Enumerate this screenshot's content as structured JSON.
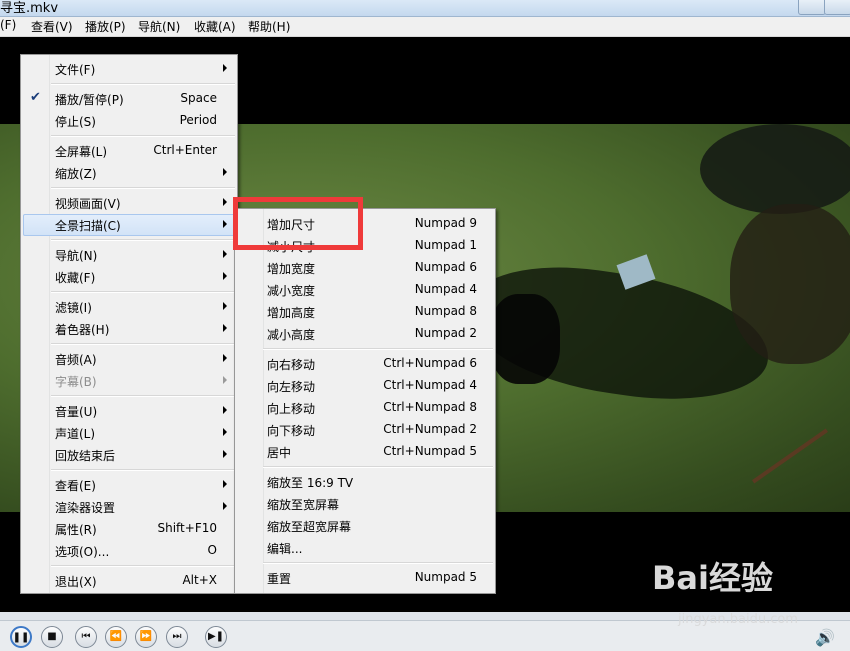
{
  "window": {
    "title": "寻宝.mkv"
  },
  "menubar": [
    "(F)",
    "查看(V)",
    "播放(P)",
    "导航(N)",
    "收藏(A)",
    "帮助(H)"
  ],
  "context_menu": {
    "items": [
      {
        "label": "文件(F)",
        "shortcut": "",
        "submenu": true
      },
      {
        "label": "播放/暂停(P)",
        "shortcut": "Space",
        "checked": true
      },
      {
        "label": "停止(S)",
        "shortcut": "Period"
      },
      {
        "label": "全屏幕(L)",
        "shortcut": "Ctrl+Enter"
      },
      {
        "label": "缩放(Z)",
        "shortcut": "",
        "submenu": true
      },
      {
        "label": "视频画面(V)",
        "shortcut": "",
        "submenu": true
      },
      {
        "label": "全景扫描(C)",
        "shortcut": "",
        "submenu": true,
        "highlighted": true
      },
      {
        "label": "导航(N)",
        "shortcut": "",
        "submenu": true
      },
      {
        "label": "收藏(F)",
        "shortcut": "",
        "submenu": true
      },
      {
        "label": "滤镜(I)",
        "shortcut": "",
        "submenu": true
      },
      {
        "label": "着色器(H)",
        "shortcut": "",
        "submenu": true
      },
      {
        "label": "音频(A)",
        "shortcut": "",
        "submenu": true
      },
      {
        "label": "字幕(B)",
        "shortcut": "",
        "submenu": true,
        "disabled": true
      },
      {
        "label": "音量(U)",
        "shortcut": "",
        "submenu": true
      },
      {
        "label": "声道(L)",
        "shortcut": "",
        "submenu": true
      },
      {
        "label": "回放结束后",
        "shortcut": "",
        "submenu": true
      },
      {
        "label": "查看(E)",
        "shortcut": "",
        "submenu": true
      },
      {
        "label": "渲染器设置",
        "shortcut": "",
        "submenu": true
      },
      {
        "label": "属性(R)",
        "shortcut": "Shift+F10"
      },
      {
        "label": "选项(O)...",
        "shortcut": "O"
      },
      {
        "label": "退出(X)",
        "shortcut": "Alt+X"
      }
    ]
  },
  "submenu": {
    "items": [
      {
        "label": "增加尺寸",
        "shortcut": "Numpad 9"
      },
      {
        "label": "减小尺寸",
        "shortcut": "Numpad 1"
      },
      {
        "label": "增加宽度",
        "shortcut": "Numpad 6"
      },
      {
        "label": "减小宽度",
        "shortcut": "Numpad 4"
      },
      {
        "label": "增加高度",
        "shortcut": "Numpad 8"
      },
      {
        "label": "减小高度",
        "shortcut": "Numpad 2"
      },
      {
        "label": "向右移动",
        "shortcut": "Ctrl+Numpad 6"
      },
      {
        "label": "向左移动",
        "shortcut": "Ctrl+Numpad 4"
      },
      {
        "label": "向上移动",
        "shortcut": "Ctrl+Numpad 8"
      },
      {
        "label": "向下移动",
        "shortcut": "Ctrl+Numpad 2"
      },
      {
        "label": "居中",
        "shortcut": "Ctrl+Numpad 5"
      },
      {
        "label": "缩放至 16:9 TV",
        "shortcut": ""
      },
      {
        "label": "缩放至宽屏幕",
        "shortcut": ""
      },
      {
        "label": "缩放至超宽屏幕",
        "shortcut": ""
      },
      {
        "label": "编辑...",
        "shortcut": ""
      },
      {
        "label": "重置",
        "shortcut": "Numpad 5"
      }
    ]
  },
  "playback_controls": [
    "pause-icon",
    "stop-icon",
    "previous-icon",
    "rewind-icon",
    "forward-icon",
    "next-icon",
    "frame-step-icon",
    "volume-icon"
  ],
  "watermark": {
    "brand": "Bai经验",
    "url": "jingyan.baidu.com"
  },
  "colors": {
    "highlight_box": "#ef3a3a",
    "menu_bg": "#f0f0f0",
    "menu_highlight": "#d2e3f7"
  }
}
